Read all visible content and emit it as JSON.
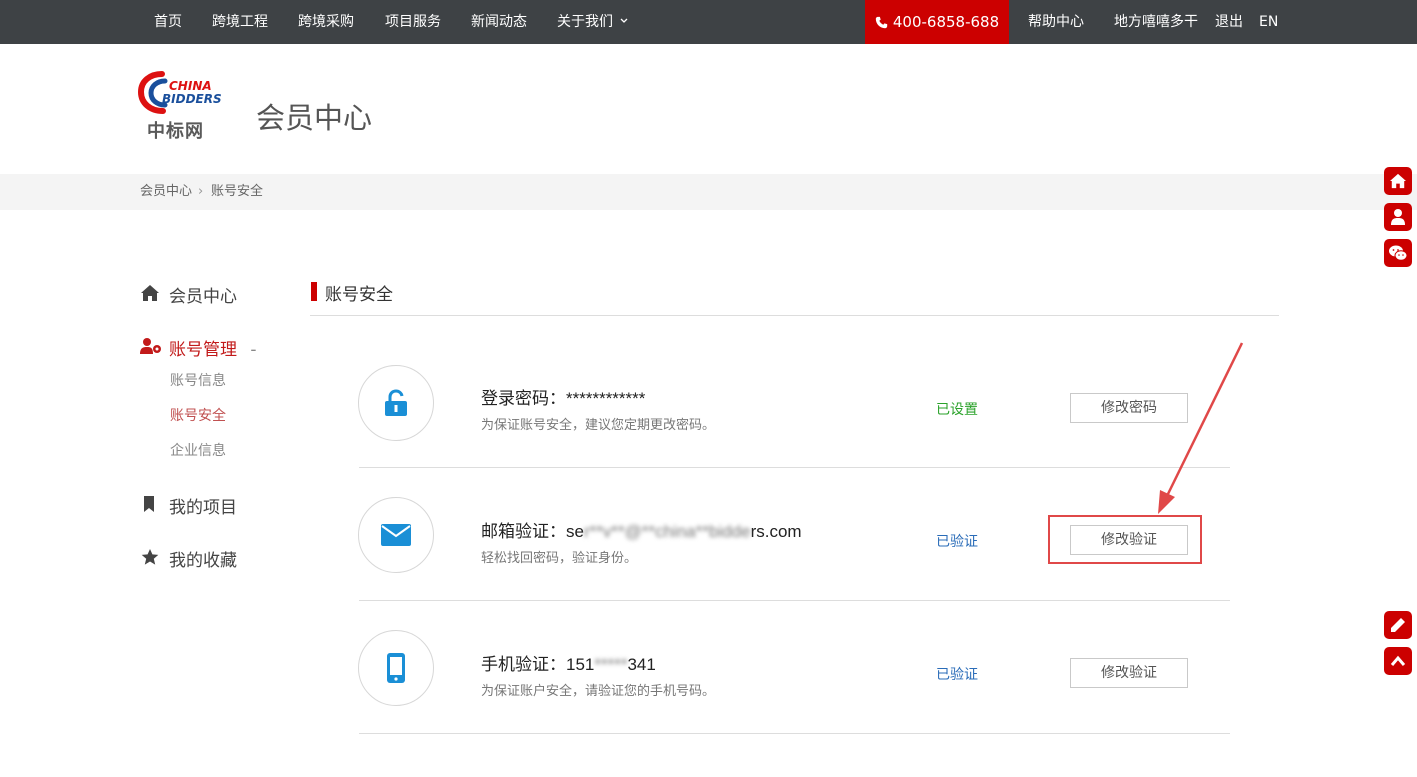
{
  "nav": {
    "home": "首页",
    "engineering": "跨境工程",
    "procurement": "跨境采购",
    "services": "项目服务",
    "news": "新闻动态",
    "about": "关于我们",
    "phone": "400-6858-688",
    "help": "帮助中心",
    "username": "地方嘻嘻多干",
    "logout": "退出",
    "lang": "EN"
  },
  "header": {
    "logo_text_line1": "CHINA",
    "logo_text_line2": "BIDDERS",
    "logo_cn": "中标网",
    "page_title": "会员中心"
  },
  "breadcrumb": {
    "root": "会员中心",
    "separator": "›",
    "current": "账号安全"
  },
  "sidebar": {
    "member_center": "会员中心",
    "account_mgmt": "账号管理",
    "account_mgmt_toggle": "-",
    "sub_items": [
      "账号信息",
      "账号安全",
      "企业信息"
    ],
    "my_projects": "我的项目",
    "my_favorites": "我的收藏"
  },
  "section": {
    "title": "账号安全"
  },
  "rows": [
    {
      "label": "登录密码：",
      "value": "************",
      "desc": "为保证账号安全，建议您定期更改密码。",
      "status": "已设置",
      "status_color": "#2aa22a",
      "button": "修改密码",
      "icon": "unlock-icon"
    },
    {
      "label": "邮箱验证：",
      "value_prefix": "se",
      "value_blur": "r**v**@**china**bidde",
      "value_suffix": "rs.com",
      "desc": "轻松找回密码，验证身份。",
      "status": "已验证",
      "status_color": "#2a6cb8",
      "button": "修改验证",
      "icon": "envelope-icon"
    },
    {
      "label": "手机验证：",
      "value_prefix": "151",
      "value_blur": "*****",
      "value_suffix": "341",
      "desc": "为保证账户安全，请验证您的手机号码。",
      "status": "已验证",
      "status_color": "#2a6cb8",
      "button": "修改验证",
      "icon": "mobile-phone-icon"
    }
  ],
  "colors": {
    "brand_red": "#cc0000",
    "icon_blue": "#1a8fd6",
    "topbar": "#3e4245"
  }
}
